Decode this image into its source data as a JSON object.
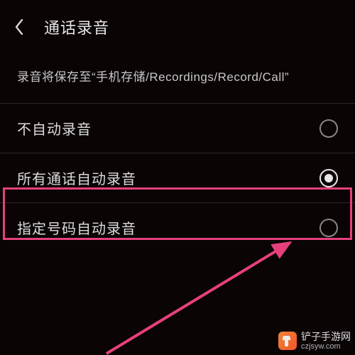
{
  "header": {
    "title": "通话录音"
  },
  "storage_note": "录音将保存至“手机存储/Recordings/Record/Call”",
  "options": [
    {
      "label": "不自动录音",
      "selected": false
    },
    {
      "label": "所有通话自动录音",
      "selected": true
    },
    {
      "label": "指定号码自动录音",
      "selected": false
    }
  ],
  "annotation": {
    "highlighted_option_index": 1,
    "arrow_color": "#e6407c"
  },
  "watermark": {
    "line1": "铲子手游网",
    "line2": "czjsyw.com"
  }
}
